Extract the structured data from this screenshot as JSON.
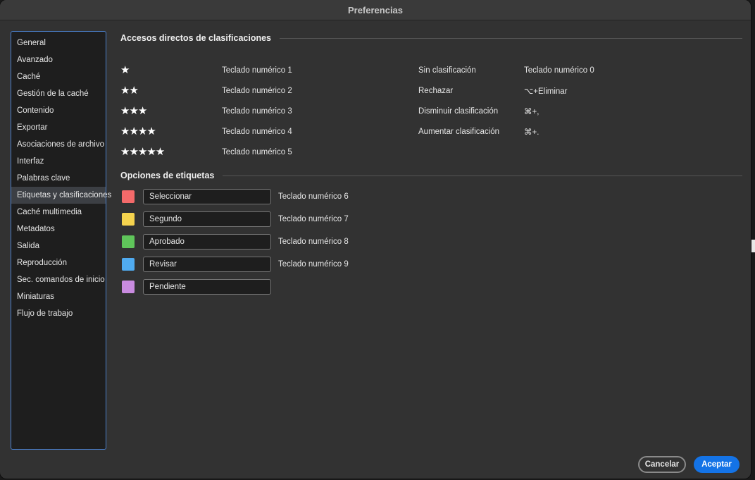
{
  "window": {
    "title": "Preferencias"
  },
  "sidebar": {
    "items": [
      {
        "label": "General"
      },
      {
        "label": "Avanzado"
      },
      {
        "label": "Caché"
      },
      {
        "label": "Gestión de la caché"
      },
      {
        "label": "Contenido"
      },
      {
        "label": "Exportar"
      },
      {
        "label": "Asociaciones de archivo"
      },
      {
        "label": "Interfaz"
      },
      {
        "label": "Palabras clave"
      },
      {
        "label": "Etiquetas y clasificaciones"
      },
      {
        "label": "Caché multimedia"
      },
      {
        "label": "Metadatos"
      },
      {
        "label": "Salida"
      },
      {
        "label": "Reproducción"
      },
      {
        "label": "Sec. comandos de inicio"
      },
      {
        "label": "Miniaturas"
      },
      {
        "label": "Flujo de trabajo"
      }
    ],
    "selected": "Etiquetas y clasificaciones"
  },
  "ratings": {
    "title": "Accesos directos de clasificaciones",
    "stars": [
      {
        "stars": "★",
        "shortcut": "Teclado numérico 1"
      },
      {
        "stars": "★★",
        "shortcut": "Teclado numérico 2"
      },
      {
        "stars": "★★★",
        "shortcut": "Teclado numérico 3"
      },
      {
        "stars": "★★★★",
        "shortcut": "Teclado numérico 4"
      },
      {
        "stars": "★★★★★",
        "shortcut": "Teclado numérico 5"
      }
    ],
    "other": [
      {
        "label": "Sin clasificación",
        "shortcut": "Teclado numérico 0"
      },
      {
        "label": "Rechazar",
        "shortcut": "⌥+Eliminar"
      },
      {
        "label": "Disminuir clasificación",
        "shortcut": "⌘+,"
      },
      {
        "label": "Aumentar clasificación",
        "shortcut": "⌘+."
      }
    ]
  },
  "labels": {
    "title": "Opciones de etiquetas",
    "items": [
      {
        "name": "Seleccionar",
        "color": "#f46a6a",
        "shortcut": "Teclado numérico 6"
      },
      {
        "name": "Segundo",
        "color": "#f5d34e",
        "shortcut": "Teclado numérico 7"
      },
      {
        "name": "Aprobado",
        "color": "#5fc55a",
        "shortcut": "Teclado numérico 8"
      },
      {
        "name": "Revisar",
        "color": "#50abf0",
        "shortcut": "Teclado numérico 9"
      },
      {
        "name": "Pendiente",
        "color": "#c98be0",
        "shortcut": ""
      }
    ]
  },
  "footer": {
    "cancel_label": "Cancelar",
    "ok_label": "Aceptar"
  },
  "colors": {
    "accent": "#1473e6",
    "sidebar_border": "#4a7fcb"
  }
}
